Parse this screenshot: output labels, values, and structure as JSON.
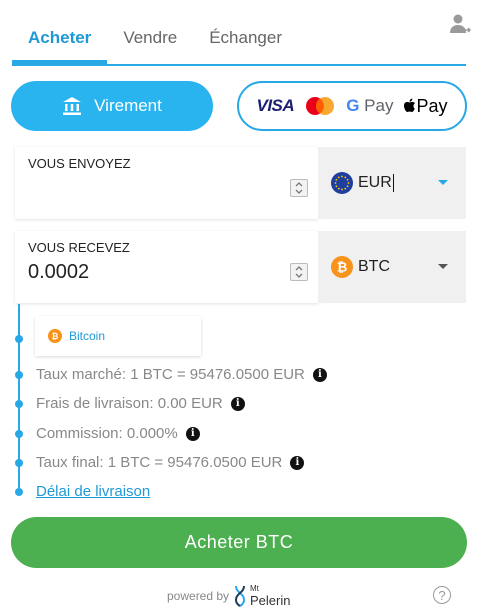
{
  "tabs": [
    {
      "label": "Acheter",
      "active": true
    },
    {
      "label": "Vendre",
      "active": false
    },
    {
      "label": "Échanger",
      "active": false
    }
  ],
  "payment": {
    "virement_label": "Virement",
    "cards": {
      "visa": "VISA",
      "gpay_g": "G",
      "gpay_text": " Pay",
      "apay_text": "Pay"
    }
  },
  "send": {
    "label": "VOUS ENVOYEZ",
    "value": "",
    "currency": "EUR",
    "currency_icon": "eu-flag-icon"
  },
  "receive": {
    "label": "VOUS RECEVEZ",
    "value": "0.0002",
    "currency": "BTC",
    "currency_icon": "bitcoin-icon"
  },
  "coin_card": {
    "label": "Bitcoin"
  },
  "details": {
    "market_rate": "Taux marché: 1 BTC = 95476.0500 EUR",
    "delivery_fee": "Frais de livraison: 0.00 EUR",
    "commission": "Commission: 0.000%",
    "final_rate": "Taux final: 1 BTC = 95476.0500 EUR",
    "delay_link": "Délai de livraison"
  },
  "buy_button": "Acheter BTC",
  "footer": {
    "powered_by": "powered by",
    "brand_mt": "Mt",
    "brand_name": "Pelerin",
    "help": "?"
  },
  "colors": {
    "accent": "#29a8e6",
    "primary_button": "#4caf50",
    "bitcoin": "#f7931a",
    "eu_blue": "#1f3fa0"
  }
}
